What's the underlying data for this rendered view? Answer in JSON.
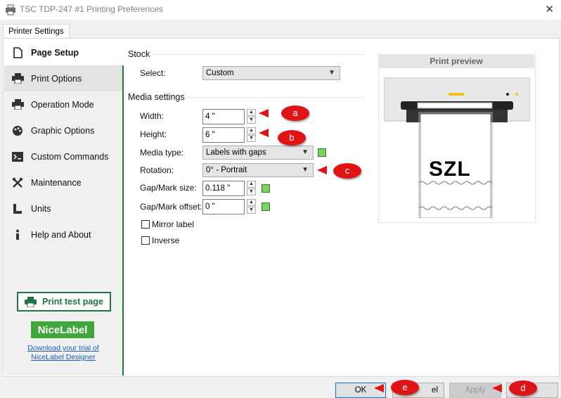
{
  "window": {
    "title": "TSC TDP-247 #1 Printing Preferences",
    "close_glyph": "✕"
  },
  "tab": {
    "label": "Printer Settings"
  },
  "sidebar": {
    "items": [
      {
        "label": "Page Setup",
        "icon": "page-icon"
      },
      {
        "label": "Print Options",
        "icon": "printer-icon"
      },
      {
        "label": "Operation Mode",
        "icon": "printer-icon"
      },
      {
        "label": "Graphic Options",
        "icon": "palette-icon"
      },
      {
        "label": "Custom Commands",
        "icon": "terminal-icon"
      },
      {
        "label": "Maintenance",
        "icon": "wrench-icon"
      },
      {
        "label": "Units",
        "icon": "ruler-icon"
      },
      {
        "label": "Help and About",
        "icon": "info-icon"
      }
    ],
    "test_button": "Print test page",
    "logo": "NiceLabel",
    "trial_link": "Download your trial of NiceLabel Designer"
  },
  "stock": {
    "section_title": "Stock",
    "select_label": "Select:",
    "select_value": "Custom"
  },
  "media": {
    "section_title": "Media settings",
    "width_label": "Width:",
    "width_value": "4 \"",
    "height_label": "Height:",
    "height_value": "6 \"",
    "media_type_label": "Media type:",
    "media_type_value": "Labels with gaps",
    "rotation_label": "Rotation:",
    "rotation_value": "0° - Portrait",
    "gap_label": "Gap/Mark size:",
    "gap_value": "0.118 \"",
    "offset_label": "Gap/Mark offset:",
    "offset_value": "0 \"",
    "mirror_label": "Mirror label",
    "inverse_label": "Inverse"
  },
  "preview": {
    "title": "Print preview",
    "sample_text": "SZL"
  },
  "buttons": {
    "ok": "OK",
    "cancel_partial": "el",
    "apply": "Apply"
  },
  "callouts": {
    "a": "a",
    "b": "b",
    "c": "c",
    "d": "d",
    "e": "e"
  },
  "colors": {
    "accent": "#217346",
    "callout": "#e01414",
    "logo_green": "#3ea63b"
  }
}
